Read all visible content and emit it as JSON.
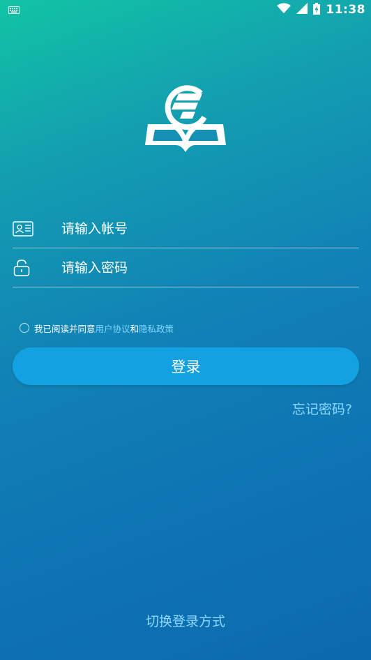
{
  "status_bar": {
    "time": "11:38",
    "icons": [
      "keyboard-icon",
      "wifi-icon",
      "signal-icon",
      "battery-charging-icon"
    ]
  },
  "login": {
    "account_placeholder": "请输入帐号",
    "password_placeholder": "请输入密码",
    "agreement_prefix": "我已阅读并同意",
    "user_agreement": "用户协议",
    "agreement_and": "和",
    "privacy_policy": "隐私政策",
    "login_button": "登录",
    "forgot_password": "忘记密码?",
    "switch_login": "切换登录方式"
  },
  "colors": {
    "button": "#14a1e1",
    "link": "#7fd6ff",
    "gradient_top": "#12c4a4",
    "gradient_bottom": "#0c6aae"
  }
}
